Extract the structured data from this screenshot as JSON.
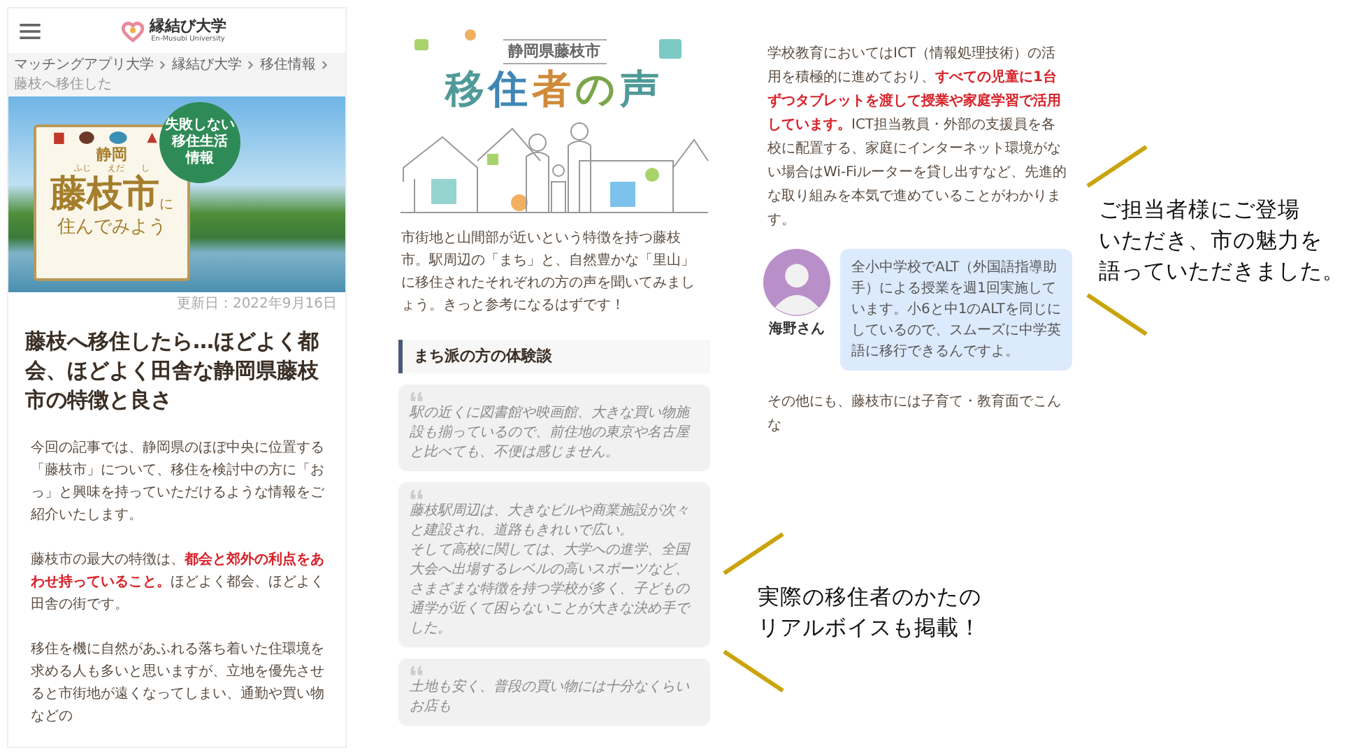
{
  "left_panel": {
    "logo": {
      "name": "縁結び大学",
      "subtitle": "En-Musubi University"
    },
    "breadcrumbs": [
      "マッチングアプリ大学",
      "縁結び大学",
      "移住情報",
      "藤枝へ移住した"
    ],
    "hero": {
      "badge": [
        "失敗しない",
        "移住生活",
        "情報"
      ],
      "prefecture": "静岡",
      "ruby": [
        "ふじ",
        "えだ",
        "し"
      ],
      "city": "藤枝市",
      "suffix": "に",
      "tagline": "住んでみよう"
    },
    "updated": "更新日：2022年9月16日",
    "title": "藤枝へ移住したら…ほどよく都会、ほどよく田舎な静岡県藤枝市の特徴と良さ",
    "paragraphs": [
      "今回の記事では、静岡県のほぼ中央に位置する「藤枝市」について、移住を検討中の方に「おっ」と興味を持っていただけるような情報をご紹介いたします。",
      "藤枝市の最大の特徴は、**都会と郊外の利点をあわせ持っていること。**ほどよく都会、ほどよく田舎の街です。",
      "移住を機に自然があふれる落ち着いた住環境を求める人も多いと思いますが、立地を優先させると市街地が遠くなってしまい、通勤や買い物などの"
    ]
  },
  "middle_panel": {
    "banner": {
      "subtitle": "静岡県藤枝市",
      "title": "移住者の声"
    },
    "intro": "市街地と山間部が近いという特徴を持つ藤枝市。駅周辺の「まち」と、自然豊かな「里山」に移住されたそれぞれの方の声を聞いてみましょう。きっと参考になるはずです！",
    "section_heading": "まち派の方の体験談",
    "quotes": [
      [
        "駅の近くに図書館や映画館、大きな買い物施設も揃っているので、前住地の東京や名古屋と比べても、不便は感じません。"
      ],
      [
        "藤枝駅周辺は、大きなビルや商業施設が次々と建設され、道路もきれいで広い。",
        "そして高校に関しては、大学への進学、全国大会へ出場するレベルの高いスポーツなど、さまざまな特徴を持つ学校が多く、子どもの通学が近くて困らないことが大きな決め手でした。"
      ],
      [
        "土地も安く、普段の買い物には十分なくらいお店も"
      ]
    ]
  },
  "right_panel": {
    "paragraph": "学校教育においてはICT（情報処理技術）の活用を積極的に進めており、**すべての児童に1台ずつタブレットを渡して授業や家庭学習で活用しています。**ICT担当教員・外部の支援員を各校に配置する、家庭にインターネット環境がない場合はWi-Fiルーターを貸し出すなど、先進的な取り組みを本気で進めていることがわかります。",
    "speaker": {
      "name": "海野さん",
      "speech": "全小中学校でALT（外国語指導助手）による授業を週1回実施しています。小6と中1のALTを同じにしているので、スムーズに中学英語に移行できるんですよ。"
    },
    "closing": "その他にも、藤枝市には子育て・教育面でこんな"
  },
  "callouts": [
    {
      "lines": [
        "ご担当者様にご登場",
        "いただき、市の魅力を",
        "語っていただきました。"
      ]
    },
    {
      "lines": [
        "実際の移住者のかたの",
        "リアルボイスも掲載！"
      ]
    }
  ]
}
